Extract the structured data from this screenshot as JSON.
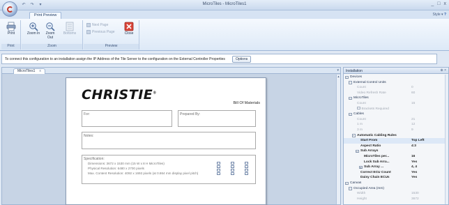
{
  "window": {
    "title": "MicroTiles - MicroTiles1",
    "style_label": "Style",
    "controls": [
      "_",
      "□",
      "x"
    ]
  },
  "quick_access": [
    "↶",
    "↷",
    "▾"
  ],
  "ribbon": {
    "tab": "Print Preview",
    "groups": {
      "print": {
        "label": "Print",
        "buttons": [
          "Print"
        ]
      },
      "zoom": {
        "label": "Zoom",
        "buttons": [
          "Zoom In",
          "Zoom Out",
          "Bottoms"
        ]
      },
      "preview": {
        "label": "Preview",
        "next_page": "Next Page",
        "previous_page": "Previous Page",
        "close": "Close"
      }
    }
  },
  "infobar": {
    "message": "To connect this configuration to an installation assign the IP Address of the Tile Server to the configuration on the External Controller Properties",
    "options_label": "Options"
  },
  "document": {
    "tab_label": "MicroTiles1",
    "tab_close": "x",
    "logo_text": "CHRISTIE",
    "logo_reg": "®",
    "bill_title": "Bill Of Materials",
    "for_label": "For:",
    "prepared_label": "Prepared By:",
    "notes_label": "Notes:",
    "spec_label": "Specification:",
    "spec_lines": [
      "Dimensions: 3672 x 1530 mm (15 W x 8 H MicroTiles)",
      "Physical Resolution: 6480 x 2700 pixels",
      "Max. Content Resolution: 4092 x 1692 pixels (at 0.864 mm display pixel pitch)"
    ]
  },
  "properties": {
    "title": "Installation",
    "rows": [
      {
        "indent": 0,
        "exp": "⊟",
        "name": "Devices",
        "value": "",
        "style": "cat"
      },
      {
        "indent": 1,
        "exp": "⊟",
        "name": "External Control Units",
        "value": "",
        "style": "cat"
      },
      {
        "indent": 2,
        "exp": "",
        "name": "Count",
        "value": "0",
        "style": "dim"
      },
      {
        "indent": 2,
        "exp": "",
        "name": "Video Refresh Rate",
        "value": "60",
        "style": "dim"
      },
      {
        "indent": 1,
        "exp": "⊟",
        "name": "MicroTiles",
        "value": "",
        "style": "cat"
      },
      {
        "indent": 2,
        "exp": "",
        "name": "Count",
        "value": "15",
        "style": "dim"
      },
      {
        "indent": 2,
        "exp": "",
        "name": "Brackets Required",
        "value": "",
        "style": "dim",
        "check": true
      },
      {
        "indent": 1,
        "exp": "⊟",
        "name": "Cables",
        "value": "",
        "style": "cat"
      },
      {
        "indent": 2,
        "exp": "",
        "name": "Count",
        "value": "21",
        "style": "dim"
      },
      {
        "indent": 2,
        "exp": "",
        "name": "1 m",
        "value": "12",
        "style": "dim"
      },
      {
        "indent": 2,
        "exp": "",
        "name": "3 m",
        "value": "9",
        "style": "dim"
      },
      {
        "indent": 2,
        "exp": "⊟",
        "name": "Automatic Cabling Rules",
        "value": "",
        "style": "bold"
      },
      {
        "indent": 3,
        "exp": "",
        "name": "Start From",
        "value": "Top Left",
        "style": "bold"
      },
      {
        "indent": 3,
        "exp": "",
        "name": "Aspect Ratio",
        "value": "4:3",
        "style": "bold"
      },
      {
        "indent": 3,
        "exp": "⊟",
        "name": "Sub Arrays",
        "value": "",
        "style": "bold"
      },
      {
        "indent": 4,
        "exp": "",
        "name": "MicroTiles per...",
        "value": "16",
        "style": "bold"
      },
      {
        "indent": 4,
        "exp": "",
        "name": "Lock Sub Arra...",
        "value": "Yes",
        "style": "bold"
      },
      {
        "indent": 4,
        "exp": "⊞",
        "name": "Sub Array ...",
        "value": "4, 4",
        "style": "bold"
      },
      {
        "indent": 3,
        "exp": "",
        "name": "Correct ECU Count",
        "value": "Yes",
        "style": "bold"
      },
      {
        "indent": 3,
        "exp": "",
        "name": "Daisy Chain ECUs",
        "value": "Yes",
        "style": "bold"
      },
      {
        "indent": 0,
        "exp": "⊟",
        "name": "Canvas",
        "value": "",
        "style": "cat"
      },
      {
        "indent": 1,
        "exp": "⊟",
        "name": "Occupied Area (mm)",
        "value": "",
        "style": "cat"
      },
      {
        "indent": 2,
        "exp": "",
        "name": "Width",
        "value": "1530",
        "style": "dim"
      },
      {
        "indent": 2,
        "exp": "",
        "name": "Height",
        "value": "3672",
        "style": "dim"
      }
    ]
  }
}
